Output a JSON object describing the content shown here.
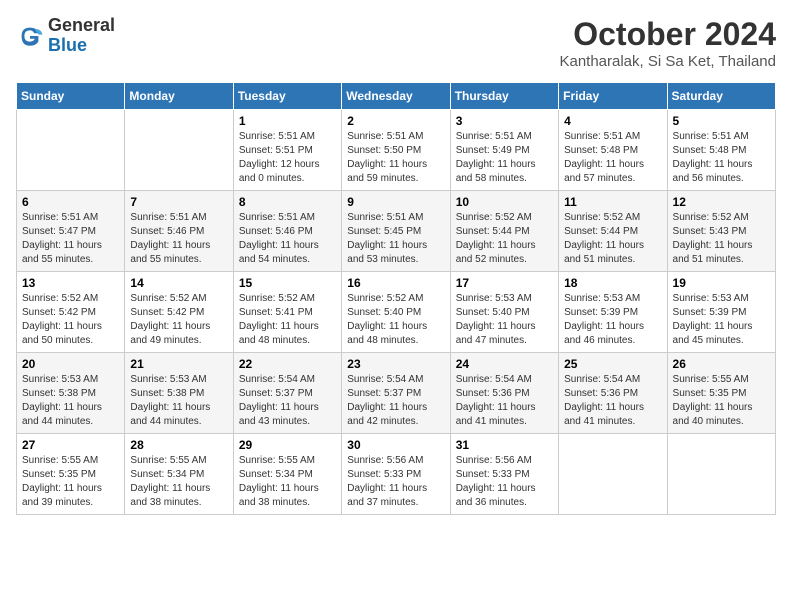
{
  "header": {
    "logo": {
      "general": "General",
      "blue": "Blue"
    },
    "month": "October 2024",
    "location": "Kantharalak, Si Sa Ket, Thailand"
  },
  "weekdays": [
    "Sunday",
    "Monday",
    "Tuesday",
    "Wednesday",
    "Thursday",
    "Friday",
    "Saturday"
  ],
  "weeks": [
    [
      {
        "day": "",
        "info": ""
      },
      {
        "day": "",
        "info": ""
      },
      {
        "day": "1",
        "sunrise": "5:51 AM",
        "sunset": "5:51 PM",
        "daylight": "12 hours and 0 minutes."
      },
      {
        "day": "2",
        "sunrise": "5:51 AM",
        "sunset": "5:50 PM",
        "daylight": "11 hours and 59 minutes."
      },
      {
        "day": "3",
        "sunrise": "5:51 AM",
        "sunset": "5:49 PM",
        "daylight": "11 hours and 58 minutes."
      },
      {
        "day": "4",
        "sunrise": "5:51 AM",
        "sunset": "5:48 PM",
        "daylight": "11 hours and 57 minutes."
      },
      {
        "day": "5",
        "sunrise": "5:51 AM",
        "sunset": "5:48 PM",
        "daylight": "11 hours and 56 minutes."
      }
    ],
    [
      {
        "day": "6",
        "sunrise": "5:51 AM",
        "sunset": "5:47 PM",
        "daylight": "11 hours and 55 minutes."
      },
      {
        "day": "7",
        "sunrise": "5:51 AM",
        "sunset": "5:46 PM",
        "daylight": "11 hours and 55 minutes."
      },
      {
        "day": "8",
        "sunrise": "5:51 AM",
        "sunset": "5:46 PM",
        "daylight": "11 hours and 54 minutes."
      },
      {
        "day": "9",
        "sunrise": "5:51 AM",
        "sunset": "5:45 PM",
        "daylight": "11 hours and 53 minutes."
      },
      {
        "day": "10",
        "sunrise": "5:52 AM",
        "sunset": "5:44 PM",
        "daylight": "11 hours and 52 minutes."
      },
      {
        "day": "11",
        "sunrise": "5:52 AM",
        "sunset": "5:44 PM",
        "daylight": "11 hours and 51 minutes."
      },
      {
        "day": "12",
        "sunrise": "5:52 AM",
        "sunset": "5:43 PM",
        "daylight": "11 hours and 51 minutes."
      }
    ],
    [
      {
        "day": "13",
        "sunrise": "5:52 AM",
        "sunset": "5:42 PM",
        "daylight": "11 hours and 50 minutes."
      },
      {
        "day": "14",
        "sunrise": "5:52 AM",
        "sunset": "5:42 PM",
        "daylight": "11 hours and 49 minutes."
      },
      {
        "day": "15",
        "sunrise": "5:52 AM",
        "sunset": "5:41 PM",
        "daylight": "11 hours and 48 minutes."
      },
      {
        "day": "16",
        "sunrise": "5:52 AM",
        "sunset": "5:40 PM",
        "daylight": "11 hours and 48 minutes."
      },
      {
        "day": "17",
        "sunrise": "5:53 AM",
        "sunset": "5:40 PM",
        "daylight": "11 hours and 47 minutes."
      },
      {
        "day": "18",
        "sunrise": "5:53 AM",
        "sunset": "5:39 PM",
        "daylight": "11 hours and 46 minutes."
      },
      {
        "day": "19",
        "sunrise": "5:53 AM",
        "sunset": "5:39 PM",
        "daylight": "11 hours and 45 minutes."
      }
    ],
    [
      {
        "day": "20",
        "sunrise": "5:53 AM",
        "sunset": "5:38 PM",
        "daylight": "11 hours and 44 minutes."
      },
      {
        "day": "21",
        "sunrise": "5:53 AM",
        "sunset": "5:38 PM",
        "daylight": "11 hours and 44 minutes."
      },
      {
        "day": "22",
        "sunrise": "5:54 AM",
        "sunset": "5:37 PM",
        "daylight": "11 hours and 43 minutes."
      },
      {
        "day": "23",
        "sunrise": "5:54 AM",
        "sunset": "5:37 PM",
        "daylight": "11 hours and 42 minutes."
      },
      {
        "day": "24",
        "sunrise": "5:54 AM",
        "sunset": "5:36 PM",
        "daylight": "11 hours and 41 minutes."
      },
      {
        "day": "25",
        "sunrise": "5:54 AM",
        "sunset": "5:36 PM",
        "daylight": "11 hours and 41 minutes."
      },
      {
        "day": "26",
        "sunrise": "5:55 AM",
        "sunset": "5:35 PM",
        "daylight": "11 hours and 40 minutes."
      }
    ],
    [
      {
        "day": "27",
        "sunrise": "5:55 AM",
        "sunset": "5:35 PM",
        "daylight": "11 hours and 39 minutes."
      },
      {
        "day": "28",
        "sunrise": "5:55 AM",
        "sunset": "5:34 PM",
        "daylight": "11 hours and 38 minutes."
      },
      {
        "day": "29",
        "sunrise": "5:55 AM",
        "sunset": "5:34 PM",
        "daylight": "11 hours and 38 minutes."
      },
      {
        "day": "30",
        "sunrise": "5:56 AM",
        "sunset": "5:33 PM",
        "daylight": "11 hours and 37 minutes."
      },
      {
        "day": "31",
        "sunrise": "5:56 AM",
        "sunset": "5:33 PM",
        "daylight": "11 hours and 36 minutes."
      },
      {
        "day": "",
        "info": ""
      },
      {
        "day": "",
        "info": ""
      }
    ]
  ]
}
